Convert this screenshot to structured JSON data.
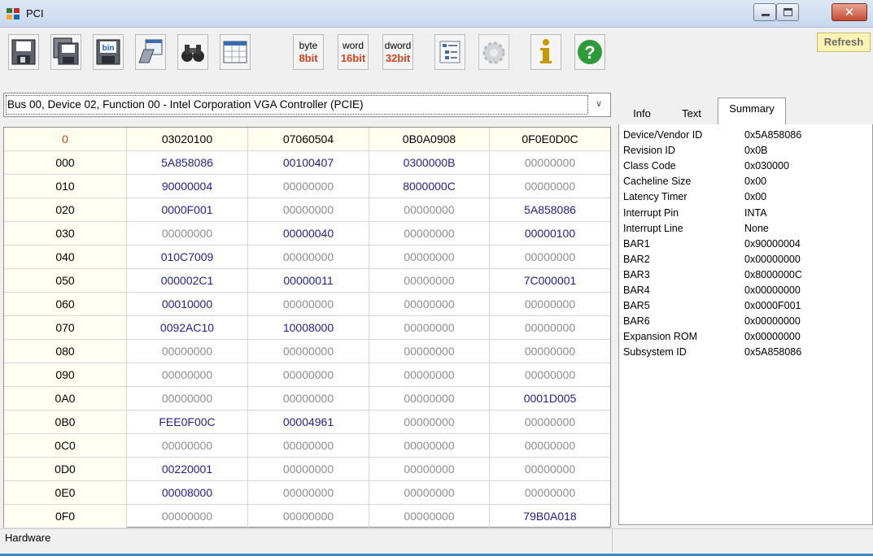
{
  "window": {
    "title": "PCI"
  },
  "toolbar": {
    "width_buttons": [
      {
        "top": "byte",
        "bottom": "8bit"
      },
      {
        "top": "word",
        "bottom": "16bit"
      },
      {
        "top": "dword",
        "bottom": "32bit"
      }
    ],
    "refresh_label": "Refresh"
  },
  "device": {
    "selected": "Bus 00, Device 02, Function 00 - Intel Corporation VGA Controller (PCIE)"
  },
  "grid": {
    "header": [
      "0",
      "03020100",
      "07060504",
      "0B0A0908",
      "0F0E0D0C"
    ],
    "rows": [
      [
        "000",
        "5A858086",
        "00100407",
        "0300000B",
        "00000000"
      ],
      [
        "010",
        "90000004",
        "00000000",
        "8000000C",
        "00000000"
      ],
      [
        "020",
        "0000F001",
        "00000000",
        "00000000",
        "5A858086"
      ],
      [
        "030",
        "00000000",
        "00000040",
        "00000000",
        "00000100"
      ],
      [
        "040",
        "010C7009",
        "00000000",
        "00000000",
        "00000000"
      ],
      [
        "050",
        "000002C1",
        "00000011",
        "00000000",
        "7C000001"
      ],
      [
        "060",
        "00010000",
        "00000000",
        "00000000",
        "00000000"
      ],
      [
        "070",
        "0092AC10",
        "10008000",
        "00000000",
        "00000000"
      ],
      [
        "080",
        "00000000",
        "00000000",
        "00000000",
        "00000000"
      ],
      [
        "090",
        "00000000",
        "00000000",
        "00000000",
        "00000000"
      ],
      [
        "0A0",
        "00000000",
        "00000000",
        "00000000",
        "0001D005"
      ],
      [
        "0B0",
        "FEE0F00C",
        "00004961",
        "00000000",
        "00000000"
      ],
      [
        "0C0",
        "00000000",
        "00000000",
        "00000000",
        "00000000"
      ],
      [
        "0D0",
        "00220001",
        "00000000",
        "00000000",
        "00000000"
      ],
      [
        "0E0",
        "00008000",
        "00000000",
        "00000000",
        "00000000"
      ],
      [
        "0F0",
        "00000000",
        "00000000",
        "00000000",
        "79B0A018"
      ]
    ]
  },
  "tabs": {
    "info": "Info",
    "text": "Text",
    "summary": "Summary"
  },
  "summary": [
    {
      "key": "Device/Vendor ID",
      "value": "0x5A858086"
    },
    {
      "key": "Revision ID",
      "value": "0x0B"
    },
    {
      "key": "Class Code",
      "value": "0x030000"
    },
    {
      "key": "Cacheline Size",
      "value": "0x00"
    },
    {
      "key": "Latency Timer",
      "value": "0x00"
    },
    {
      "key": "Interrupt Pin",
      "value": "INTA"
    },
    {
      "key": "Interrupt Line",
      "value": "None"
    },
    {
      "key": "BAR1",
      "value": "0x90000004"
    },
    {
      "key": "BAR2",
      "value": "0x00000000"
    },
    {
      "key": "BAR3",
      "value": "0x8000000C"
    },
    {
      "key": "BAR4",
      "value": "0x00000000"
    },
    {
      "key": "BAR5",
      "value": "0x0000F001"
    },
    {
      "key": "BAR6",
      "value": "0x00000000"
    },
    {
      "key": "Expansion ROM",
      "value": "0x00000000"
    },
    {
      "key": "Subsystem ID",
      "value": "0x5A858086"
    }
  ],
  "status": {
    "text": "Hardware"
  },
  "colors": {
    "nonzero": "#1f1f8f",
    "zero": "#8d8d8d",
    "header_offset": "#d0421b",
    "accent": "#3b8cc4"
  }
}
